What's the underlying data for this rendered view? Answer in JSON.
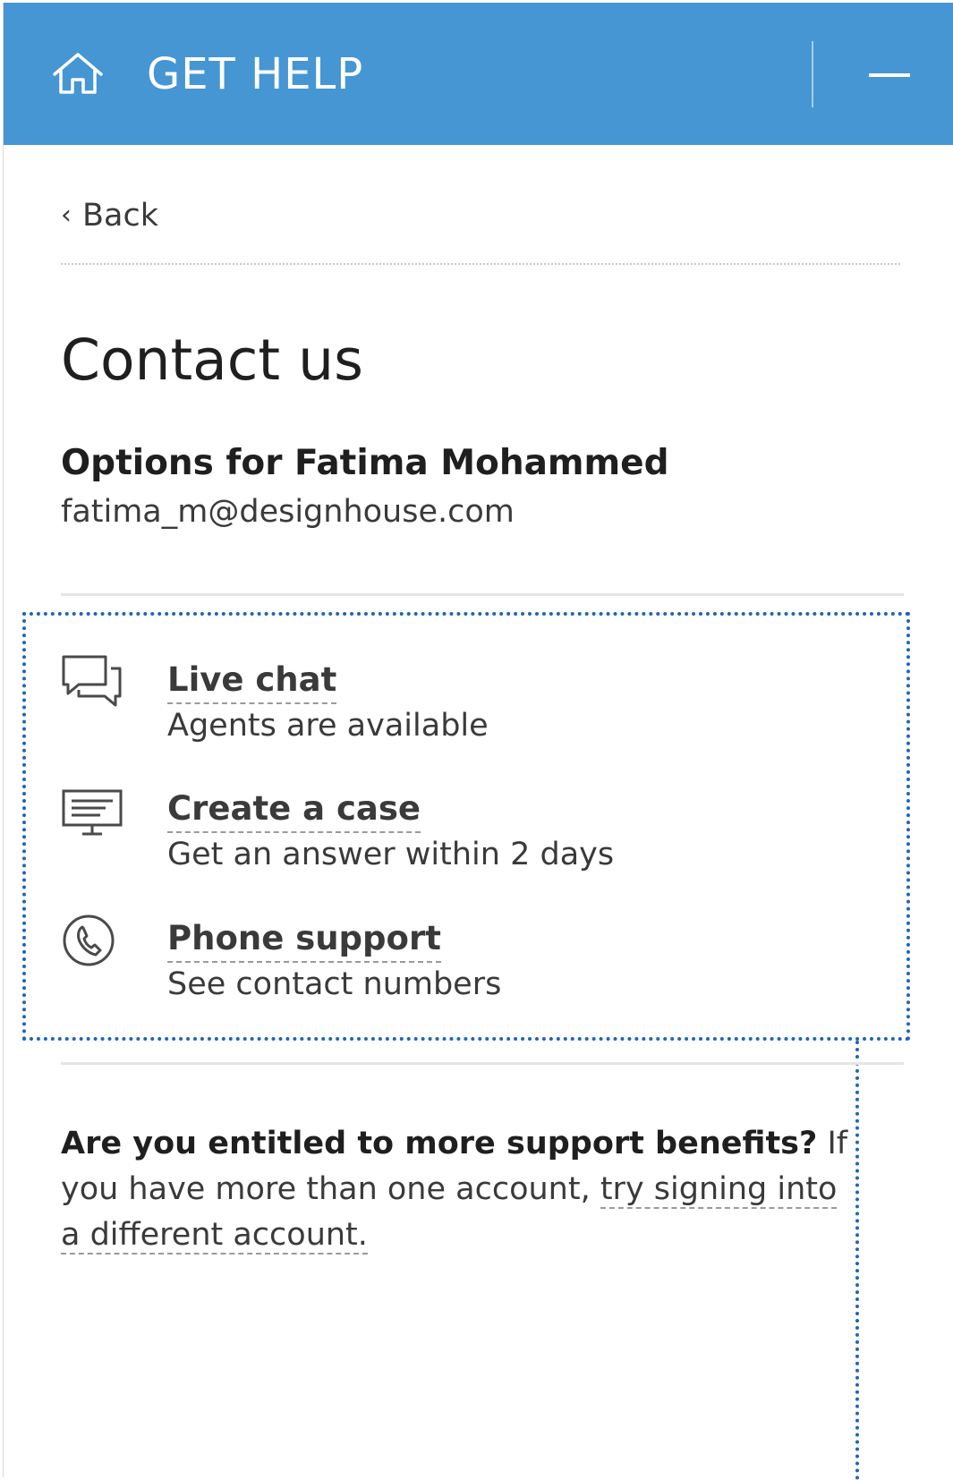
{
  "header": {
    "title": "GET HELP",
    "home_icon": "home-icon",
    "minimize_icon": "minimize-icon",
    "background": "#4596d3"
  },
  "nav": {
    "back_label": "Back",
    "back_chevron": "‹"
  },
  "main": {
    "title": "Contact us",
    "options_heading": "Options for Fatima Mohammed",
    "email": "fatima_m@designhouse.com",
    "options": [
      {
        "icon": "chat-icon",
        "title": "Live chat",
        "subtitle": "Agents are available"
      },
      {
        "icon": "monitor-icon",
        "title": "Create a case",
        "subtitle": "Get an answer within 2 days"
      },
      {
        "icon": "phone-icon",
        "title": "Phone support",
        "subtitle": "See contact numbers"
      }
    ],
    "highlight_color": "#1f66b5"
  },
  "benefits": {
    "lead": "Are you entitled to more support benefits?",
    "text": " If you have more than one account, ",
    "link": "try signing into a different account."
  }
}
